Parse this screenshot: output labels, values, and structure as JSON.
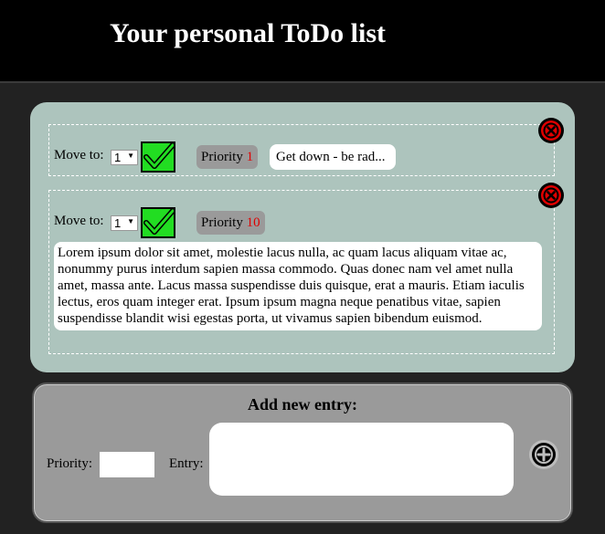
{
  "header": {
    "title": "Your personal ToDo list"
  },
  "todos": [
    {
      "move_label": "Move to:",
      "move_value": "1",
      "priority_label": "Priority",
      "priority_value": "1",
      "text": "Get down - be rad..."
    },
    {
      "move_label": "Move to:",
      "move_value": "1",
      "priority_label": "Priority",
      "priority_value": "10",
      "text": "Lorem ipsum dolor sit amet, molestie lacus nulla, ac quam lacus aliquam vitae ac, nonummy purus interdum sapien massa commodo. Quas donec nam vel amet nulla amet, massa ante. Lacus massa suspendisse duis quisque, erat a mauris. Etiam iaculis lectus, eros quam integer erat. Ipsum ipsum magna neque penatibus vitae, sapien suspendisse blandit wisi egestas porta, ut vivamus sapien bibendum euismod."
    }
  ],
  "add_form": {
    "title": "Add new entry:",
    "priority_label": "Priority:",
    "priority_value": "",
    "entry_label": "Entry:",
    "entry_value": ""
  },
  "icons": {
    "check": "check-icon",
    "delete": "delete-icon",
    "add": "add-icon"
  },
  "colors": {
    "background": "#222222",
    "header": "#000000",
    "list_panel": "#adc4bd",
    "add_panel": "#9a9a9a",
    "priority_number": "#e00000",
    "check_green": "#22dd22",
    "delete_red": "#e00000"
  }
}
